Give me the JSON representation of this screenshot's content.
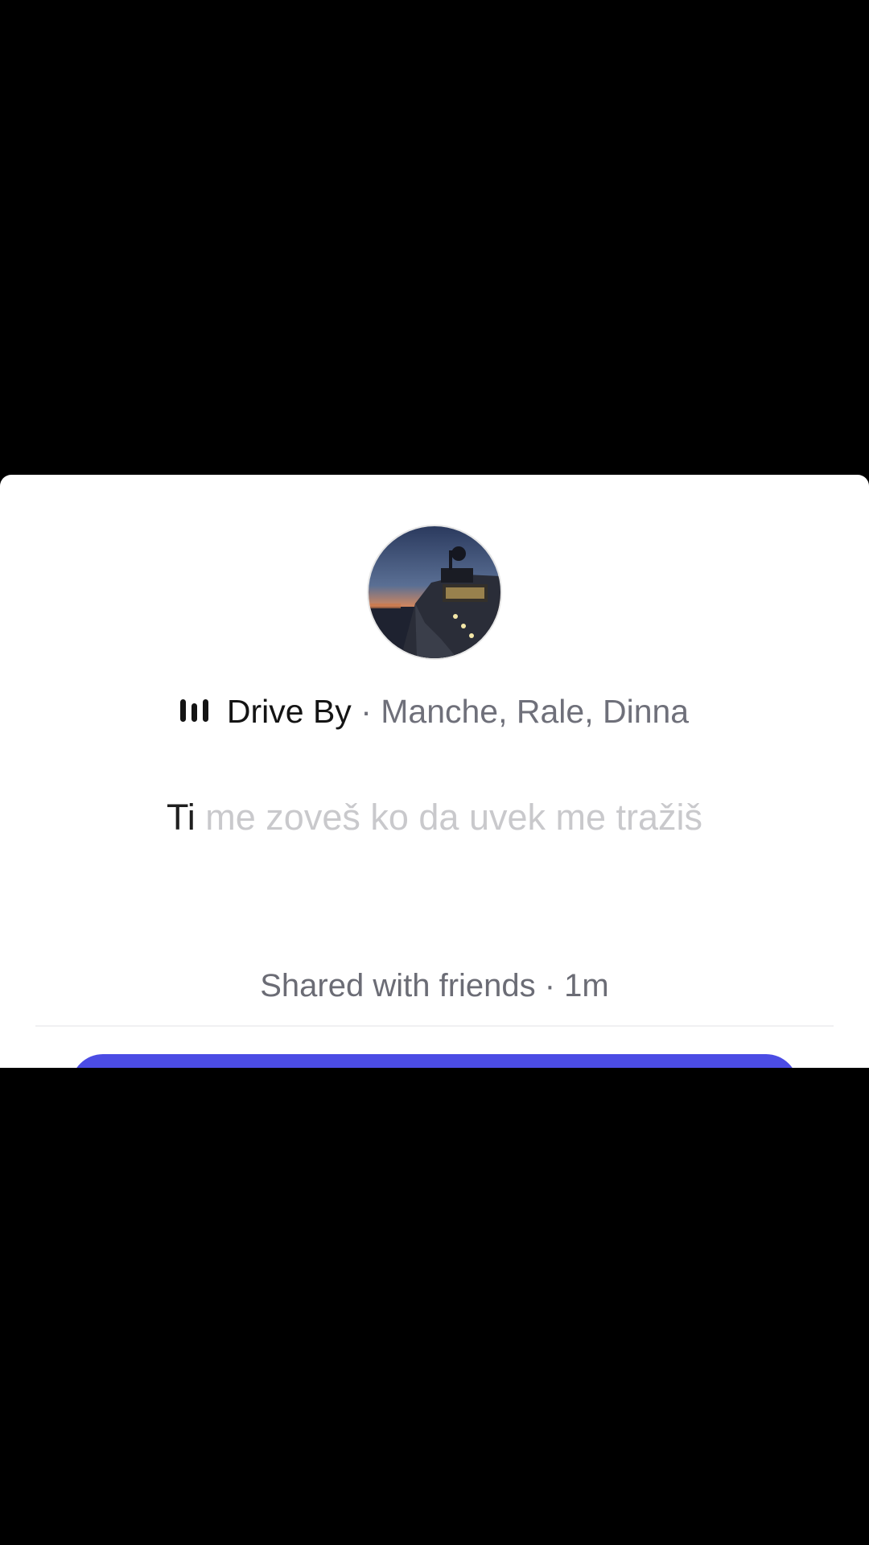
{
  "song": {
    "title": "Drive By",
    "separator": " · ",
    "artists": "Manche, Rale, Dinna",
    "icon": "audio-bars-icon"
  },
  "lyric": {
    "active": "Ti",
    "rest": " me zoveš ko da uvek me tražiš"
  },
  "share": {
    "status": "Shared with friends · 1m"
  },
  "colors": {
    "background": "#000000",
    "card": "#ffffff",
    "accent": "#4b4ce4",
    "muted_text": "#6f707a",
    "inactive_lyric": "#c9c9cc"
  }
}
